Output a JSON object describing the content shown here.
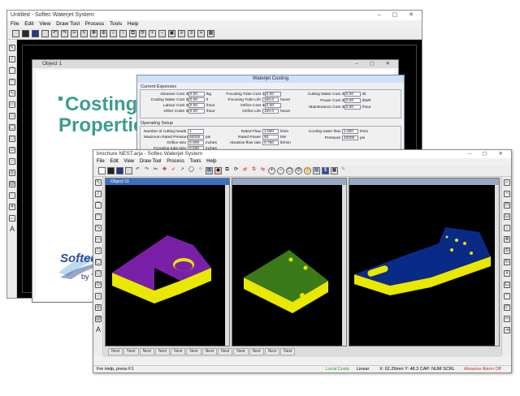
{
  "back_window": {
    "title": "Untitled - Softec Waterjet System",
    "controls": "–  ▢  ✕",
    "menu": [
      "File",
      "Edit",
      "View",
      "Draw Tool",
      "Process",
      "Tools",
      "Help"
    ],
    "object_window": {
      "title": "Object 1",
      "controls": "–  ▢  ✕"
    },
    "brochure": {
      "title_line1": "Costing",
      "title_line2": "Properties",
      "logo_text": "Softec",
      "byline": "by TechniWaterjet",
      "accent": "#3c9e8e",
      "logo_color": "#2d4e9c"
    },
    "dialog": {
      "title": "Waterjet Costing",
      "group_expenses": "Current Expenses",
      "group_setup": "Operating Setup",
      "expenses": [
        {
          "label": "Abrasive Cost",
          "prefix": "$",
          "value": "0.00",
          "unit": "/kg"
        },
        {
          "label": "Cooling Water Cost",
          "prefix": "$",
          "value": "0.00",
          "unit": "/l"
        },
        {
          "label": "Labour Cost",
          "prefix": "$",
          "value": "0.00",
          "unit": "/hour"
        },
        {
          "label": "Other Costs",
          "prefix": "$",
          "value": "0.00",
          "unit": "/hour"
        },
        {
          "label": "Focusing Tube Cost",
          "prefix": "$",
          "value": "0.00",
          "unit": ""
        },
        {
          "label": "Focusing Tube Life",
          "prefix": "",
          "value": "100.0",
          "unit": "hours"
        },
        {
          "label": "Orifice Cost",
          "prefix": "$",
          "value": "0.00",
          "unit": ""
        },
        {
          "label": "Orifice Life",
          "prefix": "",
          "value": "100.0",
          "unit": "hours"
        },
        {
          "label": "Cutting Water Cost",
          "prefix": "$",
          "value": "0.00",
          "unit": "/kl"
        },
        {
          "label": "Power Cost",
          "prefix": "$",
          "value": "0.00",
          "unit": "/kWh"
        },
        {
          "label": "Maintenance Cost",
          "prefix": "$",
          "value": "0.00",
          "unit": "/hour"
        }
      ],
      "setup": [
        {
          "label": "Number of cutting heads",
          "value": "1",
          "unit": ""
        },
        {
          "label": "Maximum Rated Pressure",
          "value": "60000",
          "unit": "psi"
        },
        {
          "label": "Orifice size",
          "value": "0.009",
          "unit": "inches"
        },
        {
          "label": "Focusing tube size",
          "value": "0.030",
          "unit": "inches"
        },
        {
          "label": "Rated Flow",
          "value": "1.000",
          "unit": "l/min"
        },
        {
          "label": "Rated Power",
          "value": "50",
          "unit": "kW"
        },
        {
          "label": "Abrasive flow rate",
          "value": "0.750",
          "unit": "lb/min"
        },
        {
          "label": "Cooling water flow",
          "value": "1.000",
          "unit": "l/min"
        },
        {
          "label": "Pressure",
          "value": "40000",
          "unit": "psi"
        }
      ]
    }
  },
  "front_window": {
    "title": "brochure NEST.arja - Softec Waterjet System",
    "controls": "–  ▢  ✕",
    "menu": [
      "File",
      "Edit",
      "View",
      "Draw Tool",
      "Process",
      "Tools",
      "Help"
    ],
    "panes": [
      {
        "title": "Object 11",
        "top_color": "#7a20a8",
        "side_color": "#e8e800"
      },
      {
        "title": "",
        "top_color": "#3a7a18",
        "side_color": "#e8e800"
      },
      {
        "title": "",
        "top_color": "#0a2a88",
        "side_color": "#e8e800"
      }
    ],
    "tabs": [
      "Nest",
      "Nest",
      "Nest",
      "Nest",
      "Nest",
      "Nest",
      "Nest",
      "Nest",
      "Nest",
      "Nest",
      "Nest",
      "Nest"
    ],
    "status_left": "For Help, press F1",
    "status_right": "X: 62.29mm Y: 48.3 CAP: NUM SCRL",
    "status_green": "Local Costs",
    "status_units": "Linear",
    "status_red": "Abrasive Alarm Off"
  }
}
